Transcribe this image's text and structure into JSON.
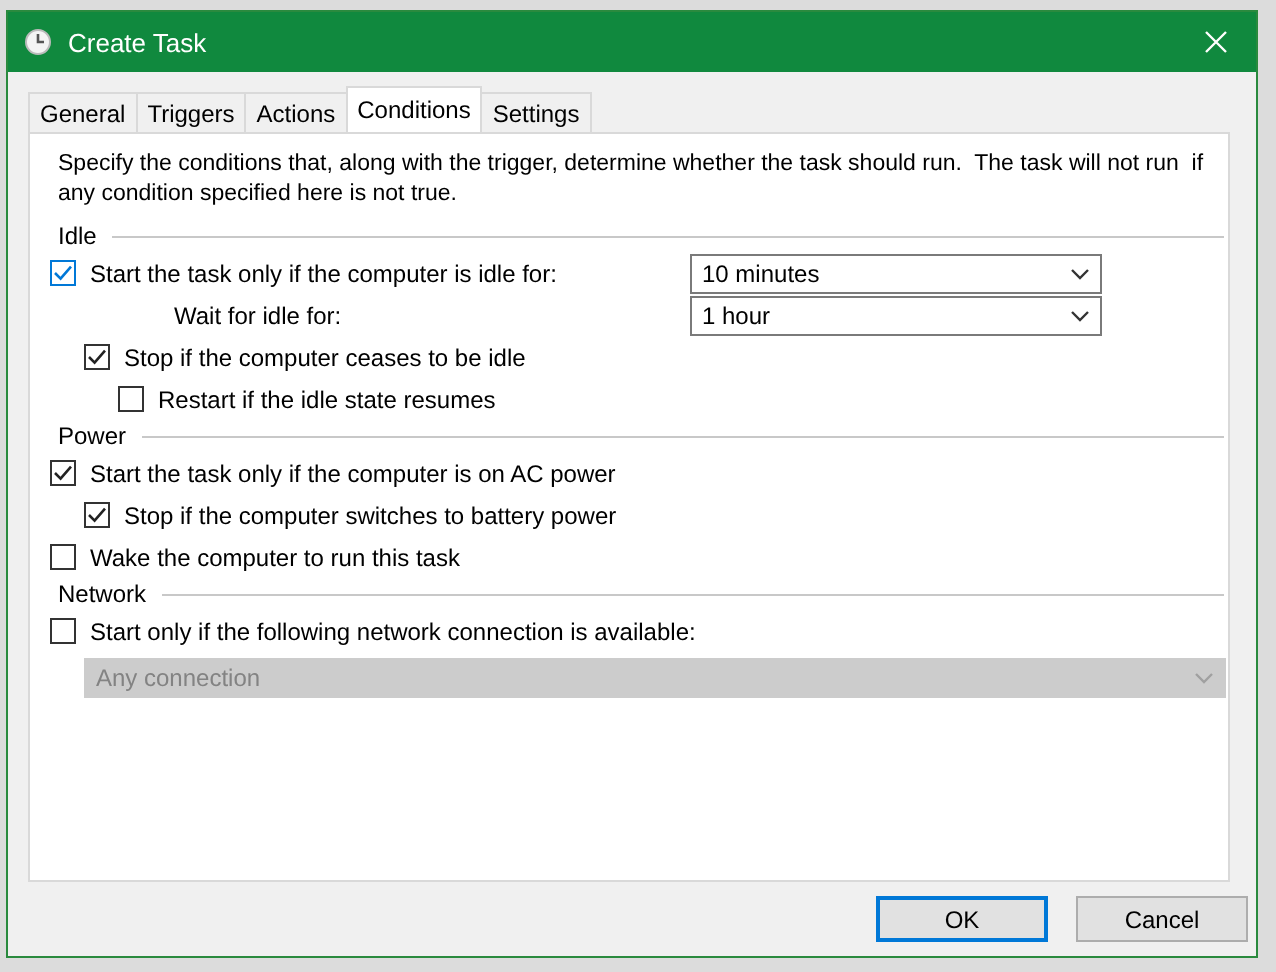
{
  "window": {
    "title": "Create Task"
  },
  "tabs": [
    {
      "label": "General",
      "selected": false
    },
    {
      "label": "Triggers",
      "selected": false
    },
    {
      "label": "Actions",
      "selected": false
    },
    {
      "label": "Conditions",
      "selected": true
    },
    {
      "label": "Settings",
      "selected": false
    }
  ],
  "description": "Specify the conditions that, along with the trigger, determine whether the task should run.  The task will not run  if any condition specified here is not true.",
  "sections": [
    {
      "title": "Idle",
      "items": [
        {
          "kind": "checkbox",
          "label": "Start the task only if the computer is idle for:",
          "checked": true,
          "focused": true,
          "dropdown": {
            "value": "10 minutes",
            "disabled": false
          },
          "children": [
            {
              "kind": "label",
              "label": "Wait for idle for:",
              "dropdown": {
                "value": "1 hour",
                "disabled": false
              }
            },
            {
              "kind": "checkbox",
              "label": "Stop if the computer ceases to be idle",
              "checked": true,
              "children": [
                {
                  "kind": "checkbox",
                  "label": "Restart if the idle state resumes",
                  "checked": false
                }
              ]
            }
          ]
        }
      ]
    },
    {
      "title": "Power",
      "items": [
        {
          "kind": "checkbox",
          "label": "Start the task only if the computer is on AC power",
          "checked": true,
          "children": [
            {
              "kind": "checkbox",
              "label": "Stop if the computer switches to battery power",
              "checked": true
            }
          ]
        },
        {
          "kind": "checkbox",
          "label": "Wake the computer to run this task",
          "checked": false
        }
      ]
    },
    {
      "title": "Network",
      "items": [
        {
          "kind": "checkbox",
          "label": "Start only if the following network connection is available:",
          "checked": false,
          "children": [
            {
              "kind": "select",
              "dropdown": {
                "value": "Any connection",
                "disabled": true
              }
            }
          ]
        }
      ]
    }
  ],
  "buttons": [
    {
      "label": "OK",
      "default": true
    },
    {
      "label": "Cancel",
      "default": false
    }
  ]
}
